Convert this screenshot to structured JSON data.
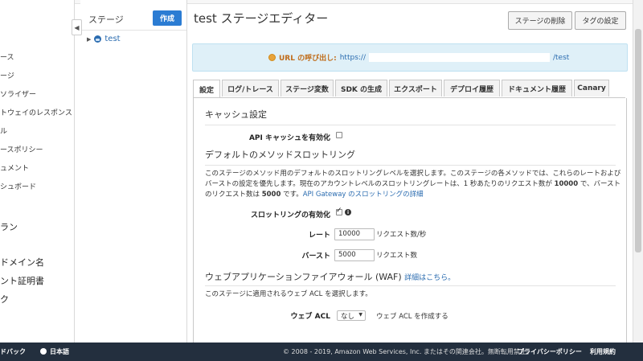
{
  "leftnav": {
    "items": [
      "ース",
      "ージ",
      "ソライザー",
      "トウェイのレスポンス",
      "ル",
      "ースポリシー",
      "ュメント",
      "シュボード"
    ],
    "group_items": [
      "ラン",
      "ドメイン名",
      "ント証明書",
      "ク"
    ]
  },
  "stages": {
    "header": "ステージ",
    "create_label": "作成",
    "tree": [
      {
        "name": "test"
      }
    ]
  },
  "page": {
    "title": "test ステージエディター",
    "delete_stage": "ステージの削除",
    "tag_settings": "タグの設定"
  },
  "invoke": {
    "label": "URL の呼び出し:",
    "url_prefix": "https://",
    "url_suffix": "/test"
  },
  "tabs": [
    "設定",
    "ログ/トレース",
    "ステージ変数",
    "SDK の生成",
    "エクスポート",
    "デプロイ履歴",
    "ドキュメント履歴",
    "Canary"
  ],
  "cache": {
    "title": "キャッシュ設定",
    "enable_label": "API キャッシュを有効化",
    "enabled": false
  },
  "throttling": {
    "title": "デフォルトのメソッドスロットリング",
    "desc_1": "このステージのメソッド用のデフォルトのスロットリングレベルを選択します。このステージの各メソッドでは、これらのレートおよびバーストの設定を優先します。現在のアカウントレベルのスロットリングレートは、1 秒あたりのリクエスト数が ",
    "desc_rate": "10000",
    "desc_2": " で、バーストのリクエスト数は ",
    "desc_burst": "5000",
    "desc_3": " です。",
    "desc_link": "API Gateway のスロットリングの詳細",
    "enable_label": "スロットリングの有効化",
    "enabled": true,
    "rate_label": "レート",
    "rate_value": "10000",
    "rate_unit": "リクエスト数/秒",
    "burst_label": "バースト",
    "burst_value": "5000",
    "burst_unit": "リクエスト数"
  },
  "waf": {
    "title": "ウェブアプリケーションファイアウォール (WAF)",
    "details_link": "詳細はこちら。",
    "desc": "このステージに適用されるウェブ ACL を選択します。",
    "acl_label": "ウェブ ACL",
    "acl_value": "なし",
    "create_acl_link": "ウェブ ACL を作成する"
  },
  "footer": {
    "feedback": "ドバック",
    "language": "日本語",
    "copyright": "© 2008 - 2019, Amazon Web Services, Inc. またはその関連会社。無断転用禁止。",
    "privacy": "プライバシーポリシー",
    "terms": "利用規約"
  },
  "colors": {
    "primary": "#2b7cd3",
    "info_bg": "#dff0f8",
    "footer_bg": "#232f3e",
    "link": "#2b6cb0"
  }
}
